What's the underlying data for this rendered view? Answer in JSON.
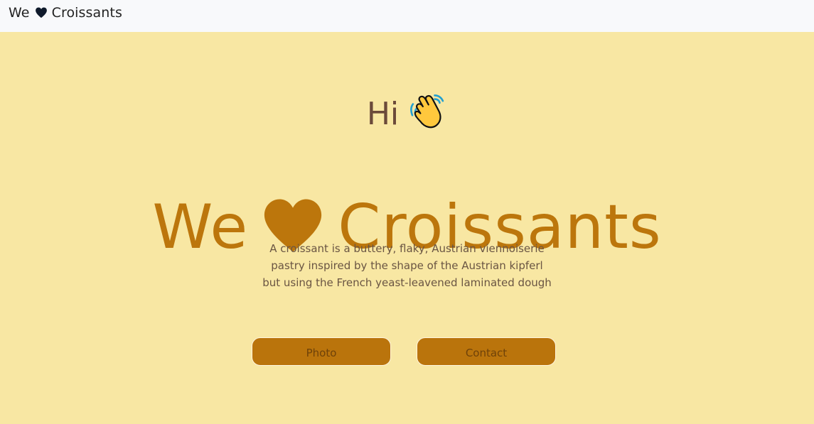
{
  "navbar": {
    "brand_before": "We",
    "brand_after": "Croissants",
    "brand_icon": "heart-icon"
  },
  "hero": {
    "greeting": "Hi",
    "greeting_icon": "waving-hand-icon",
    "title_before": "We",
    "title_after": "Croissants",
    "title_icon": "heart-icon",
    "description_lines": [
      "A croissant is a buttery, flaky, Austrian viennoiserie",
      "pastry inspired by the shape of the Austrian kipferl",
      "but using the French yeast-leavened laminated dough"
    ],
    "buttons": {
      "photo": "Photo",
      "contact": "Contact"
    }
  },
  "colors": {
    "navbar_bg": "#f8f9fb",
    "hero_bg": "#f8e7a3",
    "accent": "#bc760c",
    "button_bg": "#ba740c",
    "text_dark": "#222222"
  }
}
